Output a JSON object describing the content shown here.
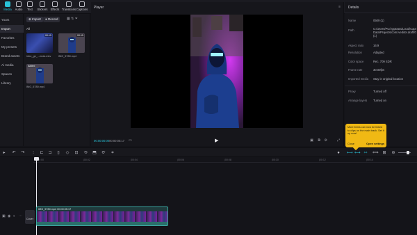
{
  "toolbar": {
    "items": [
      {
        "label": "Media",
        "icon": "media-icon"
      },
      {
        "label": "Audio",
        "icon": "audio-icon"
      },
      {
        "label": "Text",
        "icon": "text-icon"
      },
      {
        "label": "Stickers",
        "icon": "stickers-icon"
      },
      {
        "label": "Effects",
        "icon": "effects-icon"
      },
      {
        "label": "Transitions",
        "icon": "transitions-icon"
      },
      {
        "label": "Captions",
        "icon": "captions-icon"
      }
    ]
  },
  "sidebar": {
    "items": [
      {
        "label": "Yours"
      },
      {
        "label": "Import"
      },
      {
        "label": "Favorites"
      },
      {
        "label": "My presets"
      },
      {
        "label": "Brand assets"
      },
      {
        "label": "Ai media"
      },
      {
        "label": "Spaces"
      },
      {
        "label": "Library"
      }
    ]
  },
  "media": {
    "import_label": "Import",
    "record_label": "Record",
    "filter_all": "All",
    "items": [
      {
        "name": "intro_gn_...ends.mkv",
        "duration": "00:15",
        "added": ""
      },
      {
        "name": "IMG_5780.mp4",
        "duration": "00:15",
        "added": ""
      },
      {
        "name": "IMG_5780.mp4",
        "duration": "",
        "added": "Added"
      }
    ]
  },
  "player": {
    "title": "Player",
    "timecode_current": "00:00:00:00",
    "timecode_total": "00:00:05:17"
  },
  "details": {
    "title": "Details",
    "rows": [
      {
        "label": "Name",
        "value": "0509 (1)"
      },
      {
        "label": "Path",
        "value": "C:/Users/PC/AppData/Local/CapCut/User Data/Projects/com.lveditor.draft/0509 (1)"
      },
      {
        "label": "Aspect ratio",
        "value": "16:9"
      },
      {
        "label": "Resolution",
        "value": "Adapted"
      },
      {
        "label": "Color space",
        "value": "Rec. 709 SDR"
      },
      {
        "label": "Frame rate",
        "value": "30.00fps"
      },
      {
        "label": "Imported media",
        "value": "Stay in original location"
      },
      {
        "label": "Proxy",
        "value": "Turned off"
      },
      {
        "label": "Arrange layers",
        "value": "Turned on"
      }
    ]
  },
  "tooltip": {
    "text": "More items can now be linked to clips on the main track. Set it up now!",
    "close_label": "Close",
    "open_label": "Open settings"
  },
  "timeline": {
    "ticks": [
      "00:00",
      "|00:02",
      "|00:04",
      "|00:06",
      "|00:08",
      "|00:10",
      "|00:12",
      "|00:14"
    ],
    "clip_label": "IMG_5780.mp4  00:00:05:17",
    "cover_label": "Cover"
  },
  "colors": {
    "accent": "#29c2d8",
    "tooltip": "#f0b914",
    "clip_border": "#3aa6a0"
  }
}
